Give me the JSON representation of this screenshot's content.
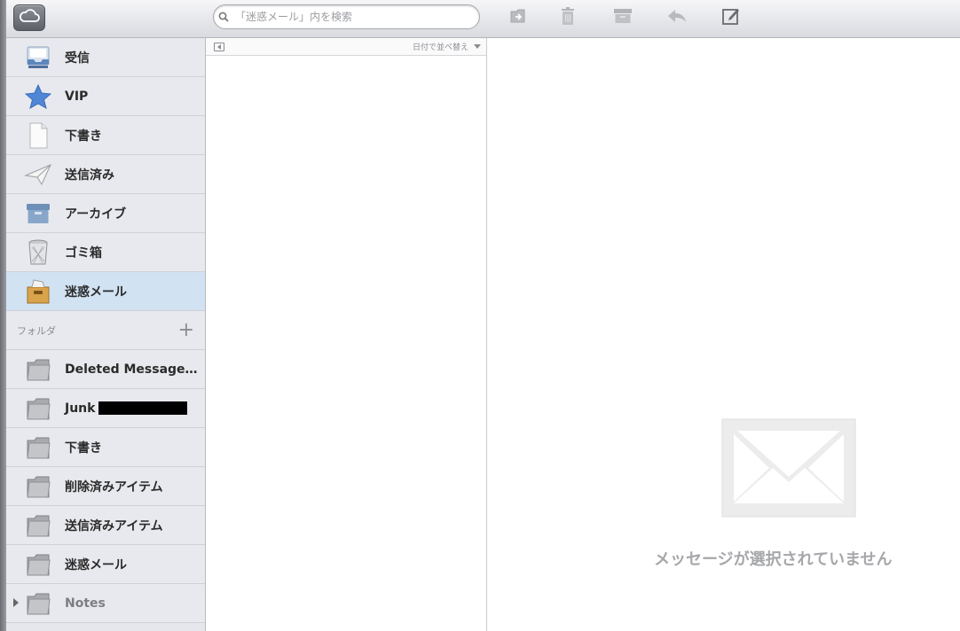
{
  "toolbar": {
    "icloud_icon": "cloud-icon",
    "search": {
      "placeholder": "「迷惑メール」内を検索"
    },
    "tools": [
      "move-to-folder-icon",
      "trash-icon",
      "archive-icon",
      "reply-icon",
      "compose-icon"
    ]
  },
  "sidebar": {
    "mailboxes": [
      {
        "label": "受信",
        "icon": "inbox-icon"
      },
      {
        "label": "VIP",
        "icon": "star-icon"
      },
      {
        "label": "下書き",
        "icon": "draft-document-icon"
      },
      {
        "label": "送信済み",
        "icon": "paper-plane-icon"
      },
      {
        "label": "アーカイブ",
        "icon": "archive-box-icon"
      },
      {
        "label": "ゴミ箱",
        "icon": "trash-can-icon"
      },
      {
        "label": "迷惑メール",
        "icon": "junk-box-icon",
        "selected": true
      }
    ],
    "folders_title": "フォルダ",
    "folders": [
      {
        "label": "Deleted Message…",
        "icon": "folder-icon"
      },
      {
        "label": "Junk",
        "icon": "folder-icon",
        "redacted": true
      },
      {
        "label": "下書き",
        "icon": "folder-icon"
      },
      {
        "label": "削除済みアイテム",
        "icon": "folder-icon"
      },
      {
        "label": "送信済みアイテム",
        "icon": "folder-icon"
      },
      {
        "label": "迷惑メール",
        "icon": "folder-icon"
      },
      {
        "label": "Notes",
        "icon": "folder-icon",
        "dim": true,
        "disclosure": true
      }
    ]
  },
  "list": {
    "sort_label": "日付で並べ替え"
  },
  "detail": {
    "empty_text": "メッセージが選択されていません"
  },
  "colors": {
    "selected_row": "#d1e2f2",
    "sidebar_bg": "#e8e9ee"
  }
}
